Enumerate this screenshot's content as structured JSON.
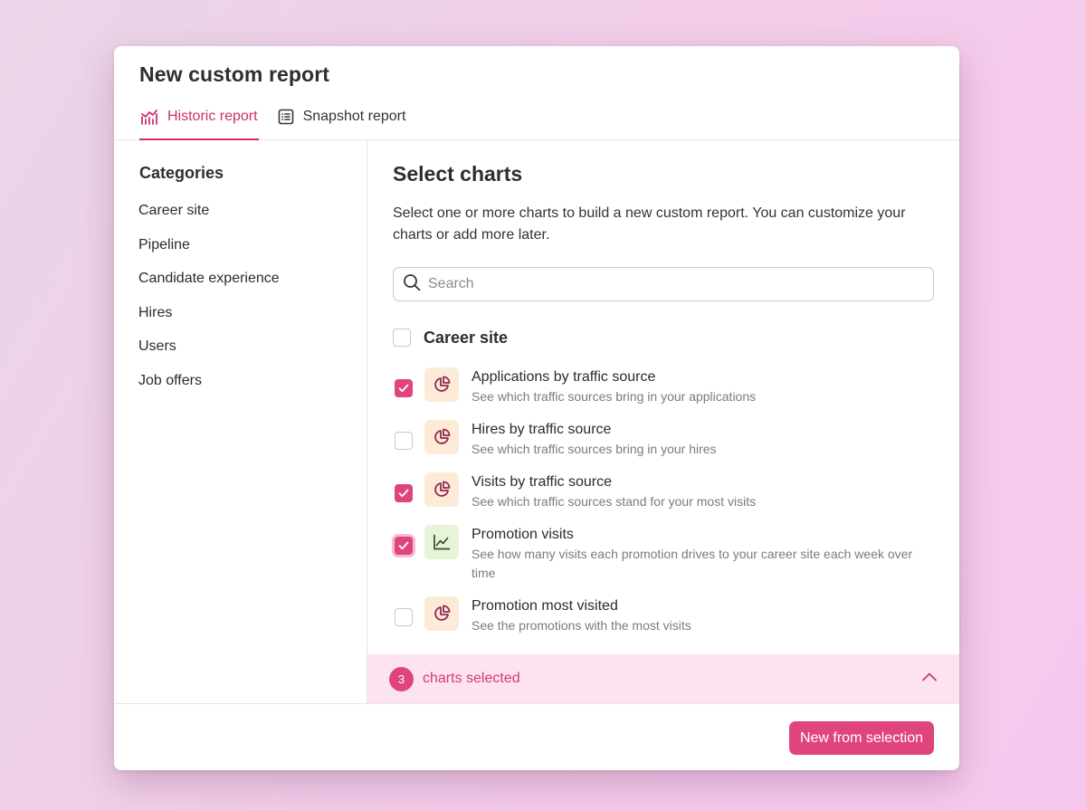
{
  "modal": {
    "title": "New custom report",
    "tabs": [
      {
        "label": "Historic report",
        "icon": "line-chart-icon",
        "active": true
      },
      {
        "label": "Snapshot report",
        "icon": "table-icon",
        "active": false
      }
    ]
  },
  "sidebar": {
    "title": "Categories",
    "items": [
      {
        "label": "Career site"
      },
      {
        "label": "Pipeline"
      },
      {
        "label": "Candidate experience"
      },
      {
        "label": "Hires"
      },
      {
        "label": "Users"
      },
      {
        "label": "Job offers"
      }
    ]
  },
  "main": {
    "title": "Select charts",
    "description": "Select one or more charts to build a new custom report. You can customize your charts or add more later.",
    "search": {
      "placeholder": "Search",
      "value": ""
    },
    "group": {
      "title": "Career site",
      "checked": false
    },
    "charts": [
      {
        "title": "Applications by traffic source",
        "description": "See which traffic sources bring in your applications",
        "checked": true,
        "icon": "pie-chart-icon"
      },
      {
        "title": "Hires by traffic source",
        "description": "See which traffic sources bring in your hires",
        "checked": false,
        "icon": "pie-chart-icon"
      },
      {
        "title": "Visits by traffic source",
        "description": "See which traffic sources stand for your most visits",
        "checked": true,
        "icon": "pie-chart-icon"
      },
      {
        "title": "Promotion visits",
        "description": "See how many visits each promotion drives to your career site each week over time",
        "checked": true,
        "icon": "line-chart-icon"
      },
      {
        "title": "Promotion most visited",
        "description": "See the promotions with the most visits",
        "checked": false,
        "icon": "pie-chart-icon"
      }
    ]
  },
  "selection": {
    "count": "3",
    "label": "charts selected",
    "toggle_icon": "chevron-up-icon"
  },
  "footer": {
    "primary_label": "New from selection"
  },
  "colors": {
    "accent": "#e0447f",
    "accent_text": "#cc2f6d",
    "selection_bg": "#fce3ef",
    "pie_icon_bg": "#fdebd8",
    "line_icon_bg": "#e7f4d8"
  }
}
